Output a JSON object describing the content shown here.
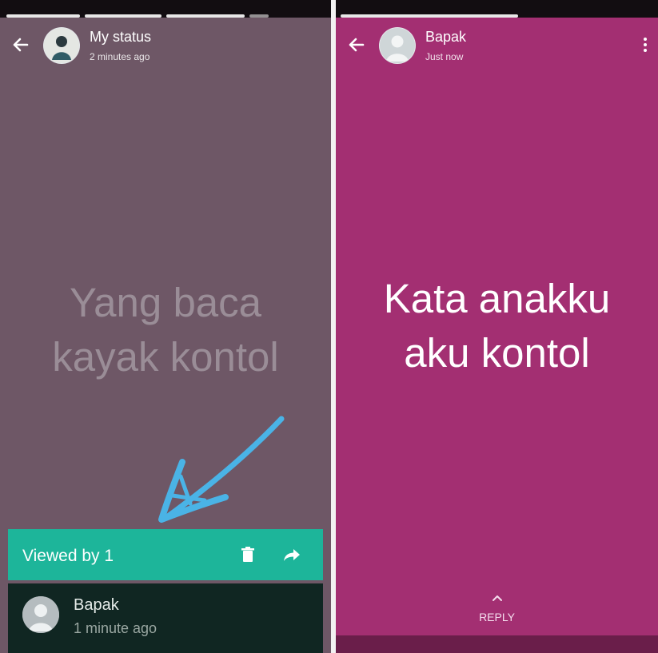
{
  "left": {
    "header": {
      "name": "My status",
      "time": "2 minutes ago"
    },
    "status_text": [
      "Yang baca",
      "kayak kontol"
    ],
    "viewed_bar": {
      "label": "Viewed by 1"
    },
    "viewer": {
      "name": "Bapak",
      "time": "1 minute ago"
    },
    "colors": {
      "background": "#6e5766",
      "viewed_bar": "#1db59a",
      "annotation_arrow": "#4ab3e6"
    }
  },
  "right": {
    "header": {
      "name": "Bapak",
      "time": "Just now"
    },
    "status_text": [
      "Kata anakku",
      "aku kontol"
    ],
    "reply_label": "REPLY",
    "colors": {
      "background": "#a32f72"
    }
  }
}
